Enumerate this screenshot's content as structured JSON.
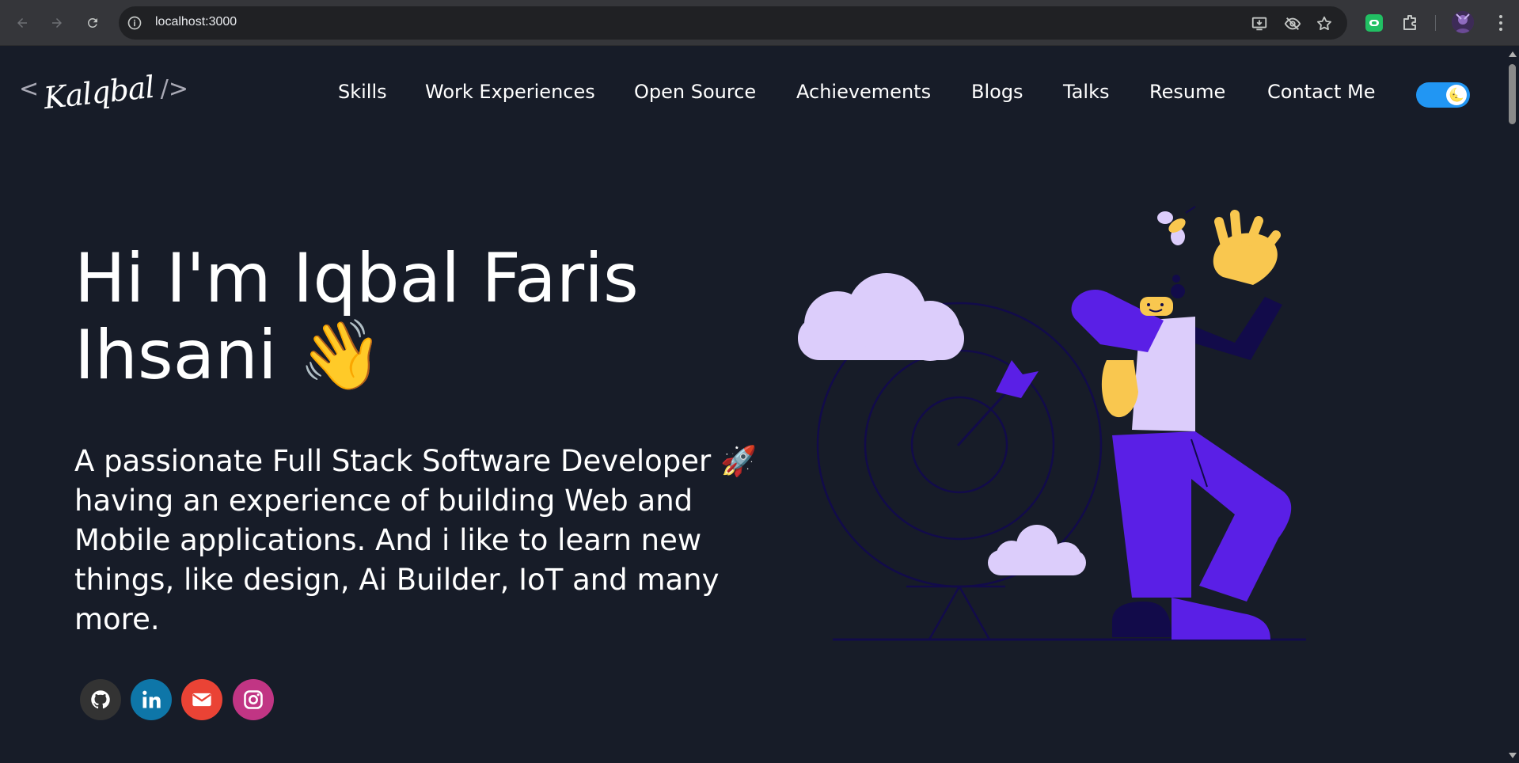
{
  "browser": {
    "url": "localhost:3000",
    "icons": [
      "back-icon",
      "forward-icon",
      "reload-icon",
      "site-info-icon",
      "install-app-icon",
      "eye-off-icon",
      "bookmark-star-icon",
      "extension-badge-icon",
      "extensions-puzzle-icon",
      "profile-avatar",
      "more-menu-icon"
    ]
  },
  "header": {
    "logo": {
      "left_bracket": "<",
      "signature": "Kalqbal",
      "right_bracket": "/>"
    },
    "nav": [
      {
        "label": "Skills"
      },
      {
        "label": "Work Experiences"
      },
      {
        "label": "Open Source"
      },
      {
        "label": "Achievements"
      },
      {
        "label": "Blogs"
      },
      {
        "label": "Talks"
      },
      {
        "label": "Resume"
      },
      {
        "label": "Contact Me"
      }
    ],
    "theme_toggle": {
      "icon": "moon-icon",
      "emoji": "🌜",
      "state": "dark"
    }
  },
  "hero": {
    "title": "Hi I'm Iqbal Faris Ihsani 👋",
    "description": "A passionate Full Stack Software Developer 🚀 having an experience of building Web and Mobile applications. And i like to learn new things, like design, Ai Builder, IoT and many more."
  },
  "socials": [
    {
      "name": "github",
      "icon": "github-icon",
      "color": "#333333"
    },
    {
      "name": "linkedin",
      "icon": "linkedin-icon",
      "color": "#0e76a8"
    },
    {
      "name": "email",
      "icon": "mail-icon",
      "color": "#ea4335"
    },
    {
      "name": "instagram",
      "icon": "instagram-icon",
      "color": "#c13584"
    }
  ],
  "colors": {
    "page_background": "#171c28",
    "accent_purple": "#5a1fe6",
    "cloud_lavender": "#dccdfb",
    "skin_yellow": "#f9c74f",
    "toggle_blue": "#2196f3"
  }
}
